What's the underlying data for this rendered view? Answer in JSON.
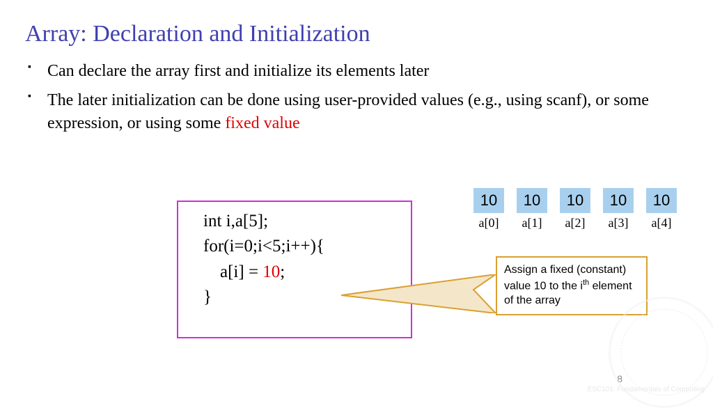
{
  "title": "Array: Declaration and Initialization",
  "bullets": {
    "b1": "Can declare the array first and initialize its elements later",
    "b2_pre": "The later initialization can be done using user-provided values (e.g., using scanf), or some expression, or using some ",
    "b2_red": "fixed value"
  },
  "code": {
    "l1": "int i,a[5];",
    "l2": "for(i=0;i<5;i++){",
    "l3_pre": "a[i] = ",
    "l3_red": "10",
    "l3_post": ";",
    "l4": "}"
  },
  "array": {
    "cells": [
      {
        "value": "10",
        "label": "a[0]"
      },
      {
        "value": "10",
        "label": "a[1]"
      },
      {
        "value": "10",
        "label": "a[2]"
      },
      {
        "value": "10",
        "label": "a[3]"
      },
      {
        "value": "10",
        "label": "a[4]"
      }
    ]
  },
  "callout": {
    "t1": "Assign a fixed (constant) value 10 to the i",
    "sup": "th",
    "t2": " element of the array"
  },
  "pagenum": "8",
  "footer": "ESC101: Fundamentals\nof Computing"
}
